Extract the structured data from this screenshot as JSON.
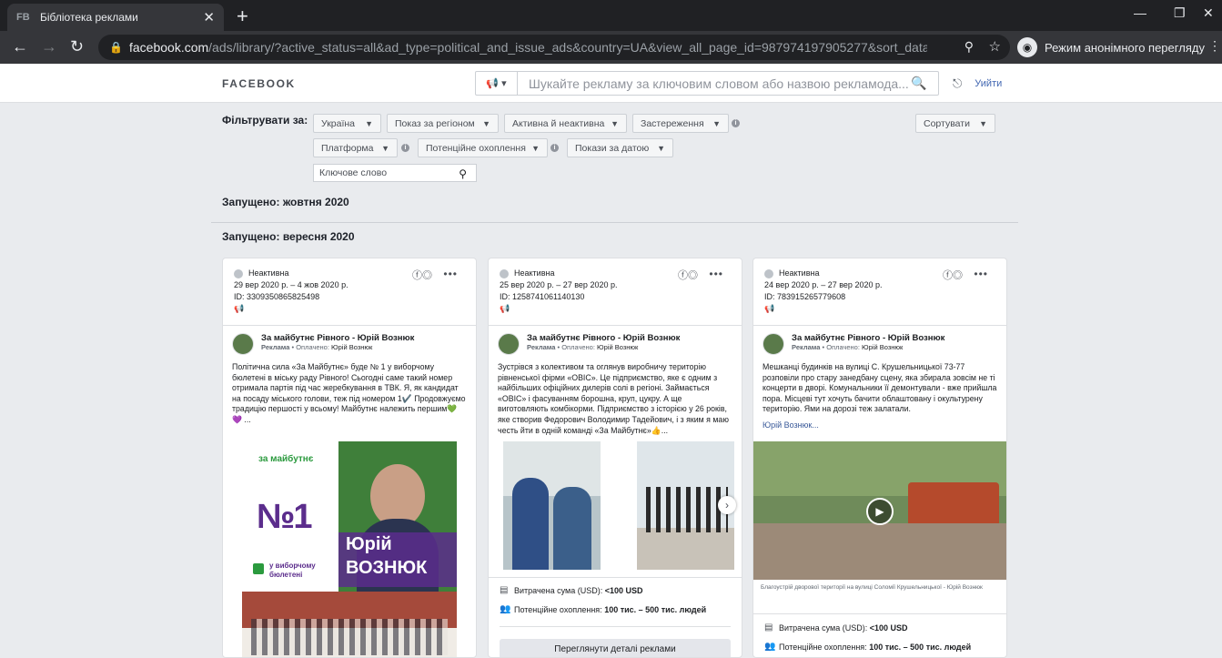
{
  "browser": {
    "tab_favicon": "FB",
    "tab_title": "Бібліотека реклами",
    "url_host": "facebook.com",
    "url_path": "/ads/library/?active_status=all&ad_type=political_and_issue_ads&country=UA&view_all_page_id=987974197905277&sort_data[di...",
    "incognito_label": "Режим анонімного перегляду"
  },
  "header": {
    "logo": "FACEBOOK",
    "search_placeholder": "Шукайте рекламу за ключовим словом або назвою рекламода...",
    "logout": "Уийти"
  },
  "filters": {
    "label": "Фільтрувати за:",
    "country": "Україна",
    "region": "Показ за регіоном",
    "status": "Активна й неактивна",
    "disclaimer": "Застереження",
    "platform": "Платформа",
    "reach": "Потенційне охоплення",
    "date": "Покази за датою",
    "keyword": "Ключове слово",
    "sort": "Сортувати"
  },
  "sections": {
    "october": "Запущено: жовтня 2020",
    "september": "Запущено: вересня 2020"
  },
  "ads": [
    {
      "status": "Неактивна",
      "dates": "29 вер 2020 р. – 4 жов 2020 р.",
      "id": "ID: 3309350865825498",
      "page": "За майбутнє Рівного - Юрій Вознюк",
      "sponsored": "Реклама",
      "paid_by_label": "Оплачено:",
      "paid_by": "Юрій Вознюк",
      "text": "Політична сила «За Майбутнє» буде № 1 у виборчому бюлетені в міську раду Рівного! Сьогодні саме такий номер отримала партія під час жеребкування в ТВК. Я, як кандидат на посаду міського голови, теж під номером 1✔️ Продовжуємо традицію першості у всьому! Майбутнє належить першим💚💜 ...",
      "poster_logo": "за майбутнє",
      "poster_number": "№1",
      "poster_sub": "у виборчому бюлетені",
      "poster_name1": "Юрій",
      "poster_name2": "ВОЗНЮК"
    },
    {
      "status": "Неактивна",
      "dates": "25 вер 2020 р. – 27 вер 2020 р.",
      "id": "ID: 1258741061140130",
      "page": "За майбутнє Рівного - Юрій Вознюк",
      "sponsored": "Реклама",
      "paid_by_label": "Оплачено:",
      "paid_by": "Юрій Вознюк",
      "text": "Зустрівся з колективом та оглянув виробничу територію рівненської фірми «ОВІС». Це підприємство, яке є одним з найбільших офіційних дилерів солі в регіоні. Займається «ОВІС» і фасуванням борошна, круп, цукру. А ще виготовляють комбікорми. Підприємство з історією у 26 років, яке створив Федорович Володимир Тадейович, і з яким я маю честь йти в одній команді «За Майбутнє»👍...",
      "spend_label": "Витрачена сума (USD):",
      "spend": "<100 USD",
      "reach_label": "Потенційне охоплення:",
      "reach": "100 тис. – 500 тис. людей",
      "details": "Переглянути деталі реклами"
    },
    {
      "status": "Неактивна",
      "dates": "24 вер 2020 р. – 27 вер 2020 р.",
      "id": "ID: 783915265779608",
      "page": "За майбутнє Рівного - Юрій Вознюк",
      "sponsored": "Реклама",
      "paid_by_label": "Оплачено:",
      "paid_by": "Юрій Вознюк",
      "text": "Мешканці будинків на вулиці С. Крушельницької 73-77 розповіли про стару занедбану сцену, яка збирала зовсім не ті концерти в дворі. Комунальники її демонтували - вже прийшла пора. Місцеві тут хочуть бачити облаштовану і окультурену територію. Ями на дорозі теж залатали.",
      "see_more": "Юрій Вознюк...",
      "caption": "Благоустрій дворової території на вулиці Соломії Крушельницької - Юрій Вознюк",
      "spend_label": "Витрачена сума (USD):",
      "spend": "<100 USD",
      "reach_label": "Потенційне охоплення:",
      "reach": "100 тис. – 500 тис. людей"
    }
  ]
}
